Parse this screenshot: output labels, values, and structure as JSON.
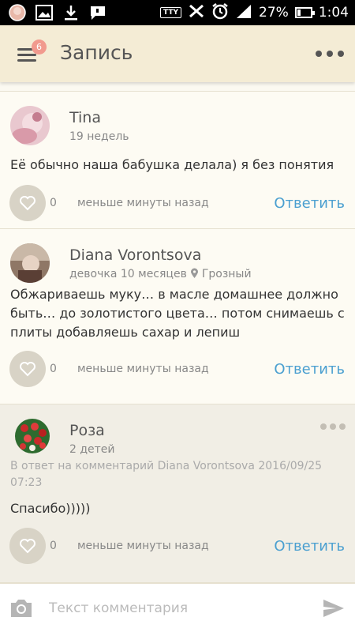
{
  "status": {
    "tty": "TTY",
    "battery": "27%",
    "battery_level": 0.27,
    "time": "1:04"
  },
  "header": {
    "title": "Запись",
    "menu_badge": "6"
  },
  "comments": [
    {
      "author": "Tina",
      "meta": "19 недель",
      "text": "Её обычно наша бабушка делала) я без понятия",
      "likes": "0",
      "time": "меньше минуты назад",
      "reply_label": "Ответить"
    },
    {
      "author": "Diana Vorontsova",
      "meta": "девочка 10 месяцев",
      "location": "Грозный",
      "text": "Обжариваешь муку… в масле домашнее должно быть… до золотистого цвета… потом снимаешь с плиты добавляешь сахар и лепиш",
      "likes": "0",
      "time": "меньше минуты назад",
      "reply_label": "Ответить"
    },
    {
      "author": "Роза",
      "meta": "2 детей",
      "reply_info": "В ответ на комментарий Diana Vorontsova 2016/09/25 07:23",
      "text": "Спасибо)))))",
      "likes": "0",
      "time": "меньше минуты назад",
      "reply_label": "Ответить"
    }
  ],
  "composer": {
    "placeholder": "Текст комментария"
  },
  "colors": {
    "accent": "#4a9fd0",
    "header_bg": "#f4ecd5",
    "badge": "#f19a8e"
  }
}
